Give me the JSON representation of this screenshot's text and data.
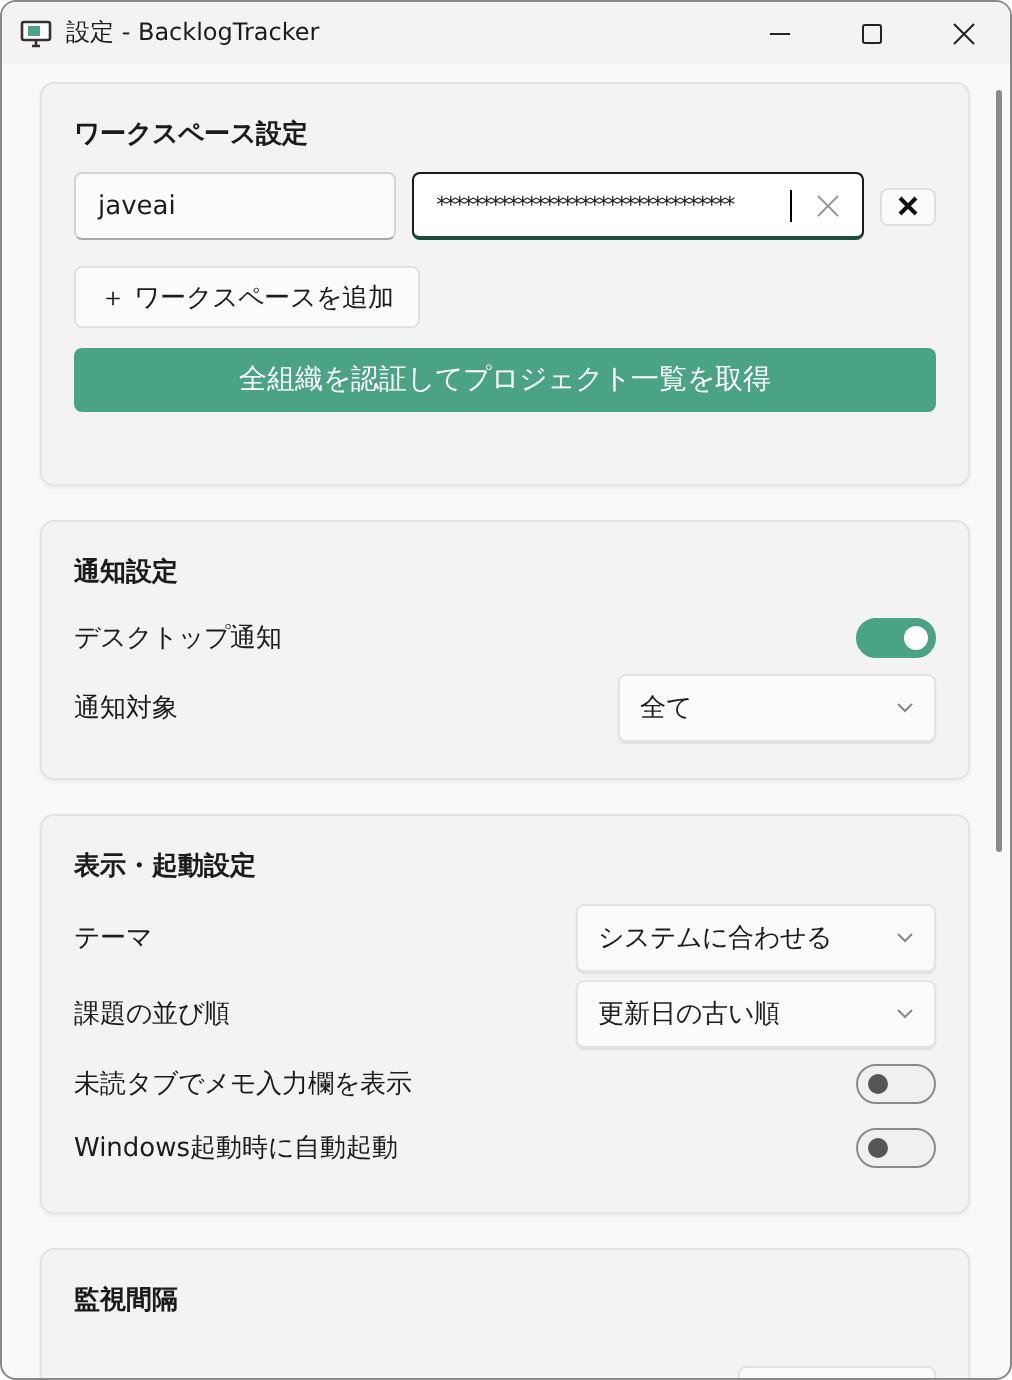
{
  "window": {
    "title": "設定 - BacklogTracker"
  },
  "workspace": {
    "title": "ワークスペース設定",
    "entries": [
      {
        "name": "javeai",
        "token": "*********************************"
      }
    ],
    "add_button": "＋ ワークスペースを追加",
    "auth_button": "全組織を認証してプロジェクト一覧を取得"
  },
  "sections": [
    {
      "title": "通知設定",
      "rows": [
        {
          "kind": "toggle",
          "label": "デスクトップ通知",
          "on": true
        },
        {
          "kind": "select",
          "label": "通知対象",
          "value": "全て"
        }
      ]
    },
    {
      "title": "表示・起動設定",
      "rows": [
        {
          "kind": "select",
          "label": "テーマ",
          "value": "システムに合わせる"
        },
        {
          "kind": "select",
          "label": "課題の並び順",
          "value": "更新日の古い順"
        },
        {
          "kind": "toggle",
          "label": "未読タブでメモ入力欄を表示",
          "on": false
        },
        {
          "kind": "toggle",
          "label": "Windows起動時に自動起動",
          "on": false
        }
      ]
    },
    {
      "title": "監視間隔",
      "rows": [
        {
          "kind": "select"
        }
      ]
    }
  ]
}
